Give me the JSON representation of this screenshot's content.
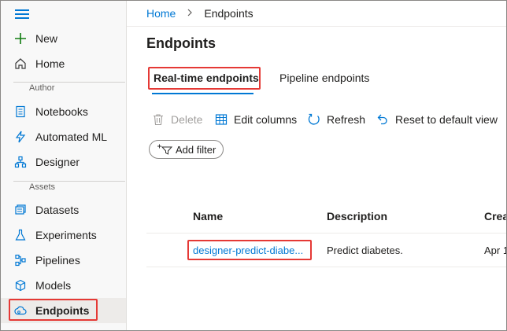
{
  "sidebar": {
    "top_items": [
      {
        "label": "New",
        "icon": "plus-icon"
      },
      {
        "label": "Home",
        "icon": "home-icon"
      }
    ],
    "sections": [
      {
        "title": "Author",
        "items": [
          {
            "label": "Notebooks",
            "icon": "notebook-icon"
          },
          {
            "label": "Automated ML",
            "icon": "automated-ml-icon"
          },
          {
            "label": "Designer",
            "icon": "designer-icon"
          }
        ]
      },
      {
        "title": "Assets",
        "items": [
          {
            "label": "Datasets",
            "icon": "datasets-icon"
          },
          {
            "label": "Experiments",
            "icon": "flask-icon"
          },
          {
            "label": "Pipelines",
            "icon": "pipelines-icon"
          },
          {
            "label": "Models",
            "icon": "cube-icon"
          },
          {
            "label": "Endpoints",
            "icon": "cloud-icon",
            "active": true
          }
        ]
      }
    ]
  },
  "breadcrumb": {
    "home": "Home",
    "current": "Endpoints"
  },
  "page": {
    "title": "Endpoints"
  },
  "tabs": [
    {
      "label": "Real-time endpoints",
      "active": true
    },
    {
      "label": "Pipeline endpoints",
      "active": false
    }
  ],
  "toolbar": {
    "delete": "Delete",
    "edit_columns": "Edit columns",
    "refresh": "Refresh",
    "reset": "Reset to default view",
    "add_filter": "Add filter"
  },
  "table": {
    "columns": [
      "Name",
      "Description",
      "Crea"
    ],
    "rows": [
      {
        "name": "designer-predict-diabe...",
        "description": "Predict diabetes.",
        "created": "Apr 1"
      }
    ]
  },
  "colors": {
    "accent": "#0078d4",
    "highlight": "#e53935"
  }
}
